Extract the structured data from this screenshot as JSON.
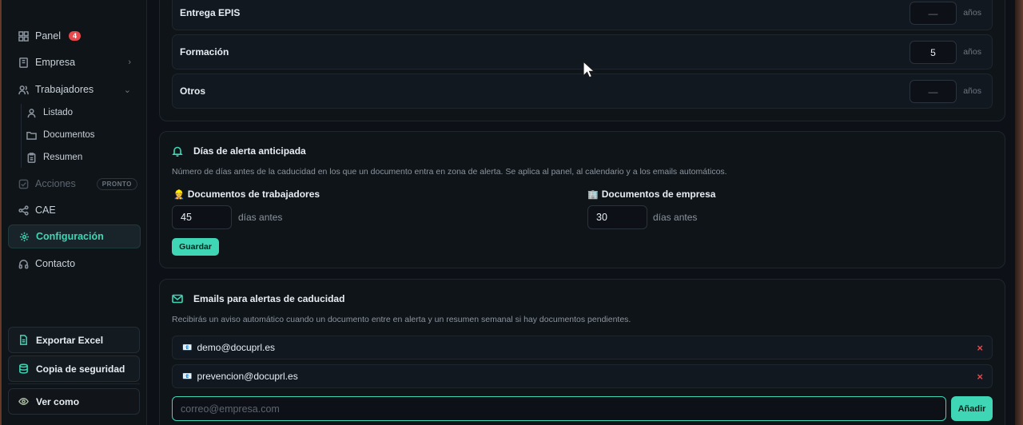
{
  "sidebar": {
    "items": [
      {
        "label": "Panel",
        "badge": "4",
        "icon": "grid-icon"
      },
      {
        "label": "Empresa",
        "icon": "building-icon"
      },
      {
        "label": "Trabajadores",
        "icon": "users-icon"
      },
      {
        "label": "Listado",
        "icon": "user-icon"
      },
      {
        "label": "Documentos",
        "icon": "folder-icon"
      },
      {
        "label": "Resumen",
        "icon": "clipboard-icon"
      },
      {
        "label": "Acciones",
        "badge": "PRONTO",
        "icon": "checkbox-icon"
      },
      {
        "label": "CAE",
        "icon": "share-icon"
      },
      {
        "label": "Configuración",
        "icon": "gear-icon"
      },
      {
        "label": "Contacto",
        "icon": "headphones-icon"
      }
    ],
    "export_label": "Exportar Excel",
    "backup_label": "Copia de seguridad",
    "viewas_label": "Ver como"
  },
  "expiry_rows": [
    {
      "label": "Entrega EPIS",
      "value": "—",
      "unit": "años"
    },
    {
      "label": "Formación",
      "value": "5",
      "unit": "años"
    },
    {
      "label": "Otros",
      "value": "—",
      "unit": "años"
    }
  ],
  "alert_days": {
    "title": "Días de alerta anticipada",
    "description": "Número de días antes de la caducidad en los que un documento entra en zona de alerta. Se aplica al panel, al calendario y a los emails automáticos.",
    "workers_label": "Documentos de trabajadores",
    "workers_emoji": "👷",
    "workers_value": "45",
    "company_label": "Documentos de empresa",
    "company_emoji": "🏢",
    "company_value": "30",
    "suffix": "días antes",
    "save_label": "Guardar"
  },
  "emails": {
    "title": "Emails para alertas de caducidad",
    "description": "Recibirás un aviso automático cuando un documento entre en alerta y un resumen semanal si hay documentos pendientes.",
    "list": [
      "demo@docuprl.es",
      "prevencion@docuprl.es"
    ],
    "remove_glyph": "×",
    "placeholder": "correo@empresa.com",
    "add_label": "Añadir"
  },
  "colors": {
    "accent": "#3fd6b5",
    "danger": "#e5484d",
    "background": "#0d1117"
  }
}
